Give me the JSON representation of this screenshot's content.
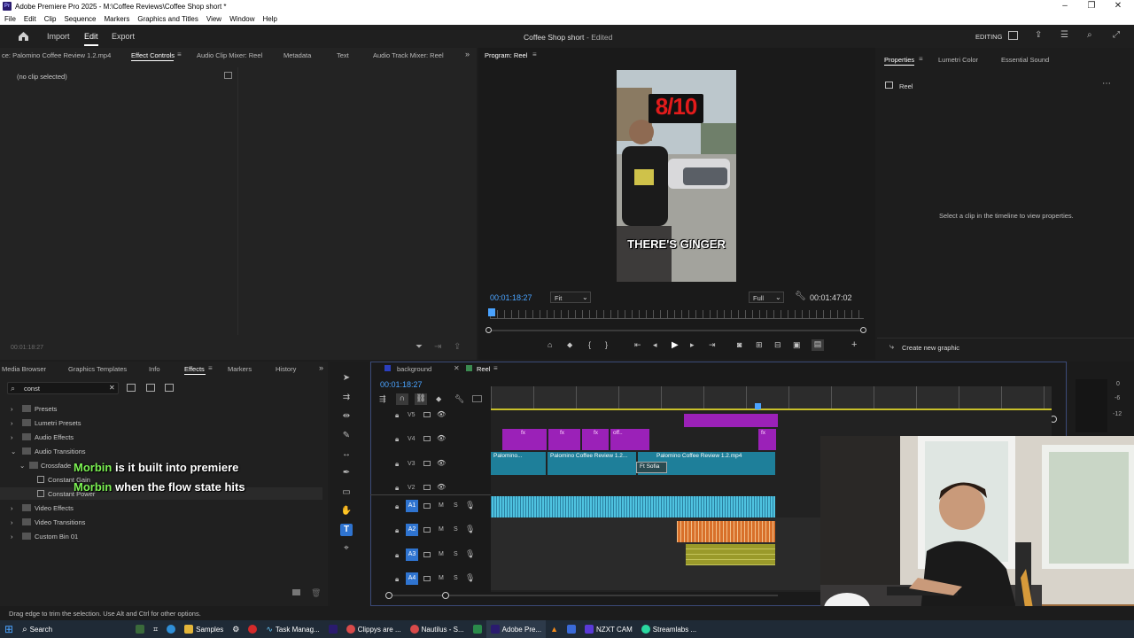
{
  "window": {
    "title": "Adobe Premiere Pro 2025 - M:\\Coffee Reviews\\Coffee Shop short *",
    "app_icon": "Pr"
  },
  "menu": [
    "File",
    "Edit",
    "Clip",
    "Sequence",
    "Markers",
    "Graphics and Titles",
    "View",
    "Window",
    "Help"
  ],
  "header": {
    "tabs": [
      "Import",
      "Edit",
      "Export"
    ],
    "active_tab": "Edit",
    "project_title": "Coffee Shop short",
    "status": "- Edited",
    "workspace": "EDITING"
  },
  "effect_controls": {
    "tabs": [
      "ce: Palomino Coffee Review 1.2.mp4",
      "Effect Controls",
      "Audio Clip Mixer: Reel",
      "Metadata",
      "Text",
      "Audio Track Mixer: Reel"
    ],
    "active_tab": "Effect Controls",
    "no_clip": "(no clip selected)",
    "timecode": "00:01:18:27"
  },
  "program": {
    "tab": "Program: Reel",
    "timecode": "00:01:18:27",
    "fit": "Fit",
    "quality": "Full",
    "duration": "00:01:47:02",
    "overlay_top": "8/10",
    "overlay_bottom": "THERE'S GINGER"
  },
  "properties": {
    "tabs": [
      "Properties",
      "Lumetri Color",
      "Essential Sound"
    ],
    "active_tab": "Properties",
    "item": "Reel",
    "hint": "Select a clip in the timeline to view properties.",
    "button": "Create new graphic"
  },
  "effects_panel": {
    "tabs": [
      "Media Browser",
      "Graphics Templates",
      "Info",
      "Effects",
      "Markers",
      "History"
    ],
    "active_tab": "Effects",
    "search_value": "const",
    "tree": [
      {
        "label": "Presets",
        "level": 0
      },
      {
        "label": "Lumetri Presets",
        "level": 0
      },
      {
        "label": "Audio Effects",
        "level": 0
      },
      {
        "label": "Audio Transitions",
        "level": 0
      },
      {
        "label": "Crossfade",
        "level": 1
      },
      {
        "label": "Constant Gain",
        "level": 2
      },
      {
        "label": "Constant Power",
        "level": 2
      },
      {
        "label": "Video Effects",
        "level": 0
      },
      {
        "label": "Video Transitions",
        "level": 0
      },
      {
        "label": "Custom Bin 01",
        "level": 0
      }
    ]
  },
  "captions": [
    {
      "name": "Morbin",
      "text": "is it built into premiere"
    },
    {
      "name": "Morbin",
      "text": "when the flow state hits"
    }
  ],
  "timeline": {
    "tabs": [
      "background",
      "Reel"
    ],
    "active_tab": "Reel",
    "timecode": "00:01:18:27",
    "video_tracks": [
      "V5",
      "V4",
      "V3",
      "V2"
    ],
    "audio_tracks": [
      "A1",
      "A2",
      "A3",
      "A4"
    ],
    "clips": {
      "v4_labels": [
        "fx",
        "fx",
        "fx",
        "fx",
        "off..",
        "fx",
        "fx"
      ],
      "v3_clip1": "Palomino...",
      "v3_clip2": "Palomino Coffee Review 1.2...",
      "v3_clip3": "Palomino Coffee Review 1.2.mp4",
      "v3_clip4": "Ft Sofia"
    },
    "track_buttons": {
      "mute": "M",
      "solo": "S"
    }
  },
  "meters": {
    "labels": [
      "0",
      "-6",
      "-12"
    ]
  },
  "status_bar": "Drag edge to trim the selection. Use Alt and Ctrl for other options.",
  "taskbar": {
    "search": "Search",
    "items": [
      "Samples",
      "Task Manag...",
      "Clippys are ...",
      "Nautilus - S...",
      "Adobe Pre...",
      "NZXT CAM",
      "Streamlabs ..."
    ]
  },
  "colors": {
    "accent_blue": "#4aa3ff",
    "clip_purple": "#9b21b8",
    "clip_teal": "#1e7f9a",
    "audio_blue": "#4fc3e0",
    "audio_orange": "#d8702a",
    "audio_olive": "#9a9a2a",
    "caption_green": "#7cf253"
  }
}
